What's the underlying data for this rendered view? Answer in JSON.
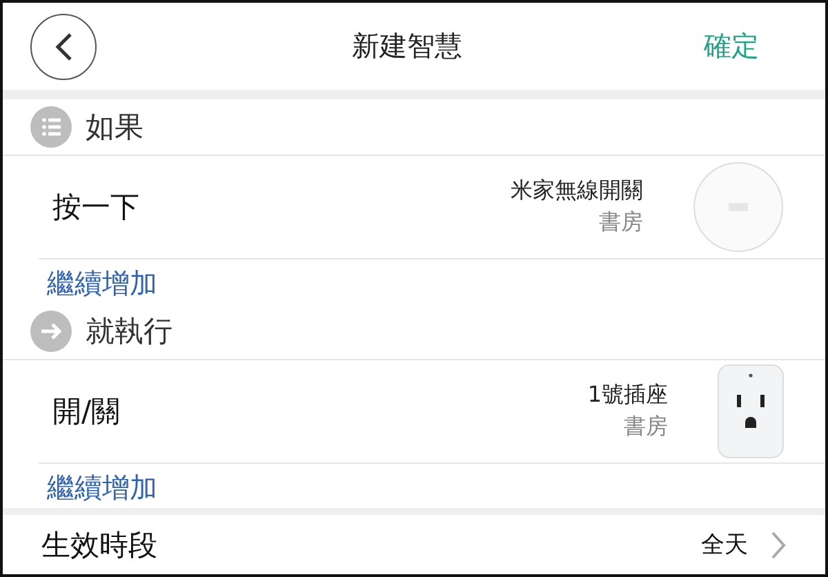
{
  "header": {
    "title": "新建智慧",
    "confirm": "確定"
  },
  "sections": [
    {
      "kind": "condition",
      "title": "如果",
      "rows": [
        {
          "action": "按一下",
          "device": "米家無線開關",
          "room": "書房",
          "kind": "button"
        }
      ],
      "add_label": "繼續增加"
    },
    {
      "kind": "action",
      "title": "就執行",
      "rows": [
        {
          "action": "開/關",
          "device": "1號插座",
          "room": "書房",
          "kind": "socket"
        }
      ],
      "add_label": "繼續增加"
    }
  ],
  "period": {
    "label": "生效時段",
    "value": "全天"
  }
}
